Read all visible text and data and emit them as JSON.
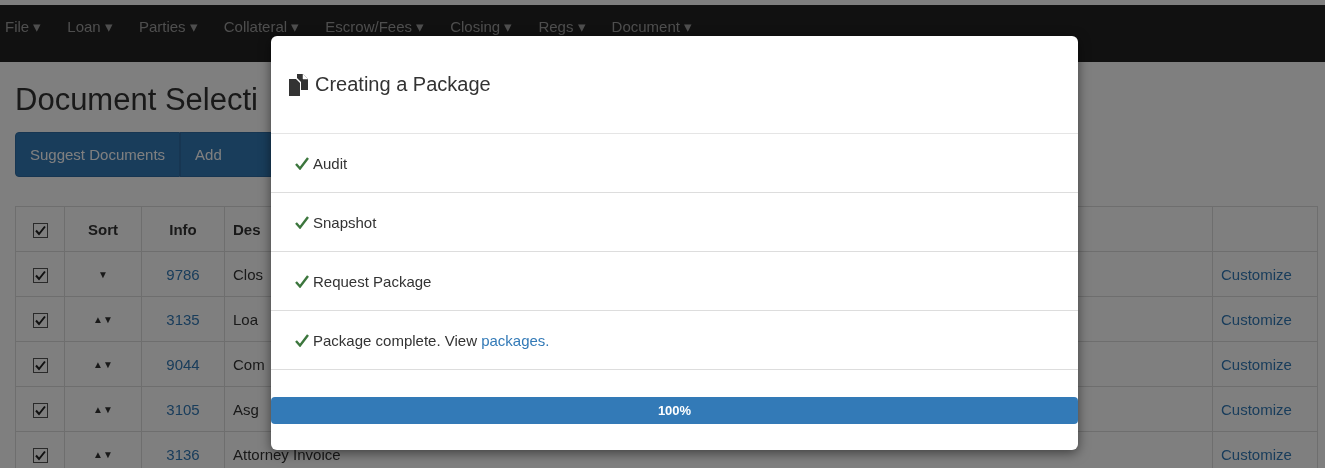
{
  "navbar": {
    "items": [
      {
        "label": "File"
      },
      {
        "label": "Loan"
      },
      {
        "label": "Parties"
      },
      {
        "label": "Collateral"
      },
      {
        "label": "Escrow/Fees"
      },
      {
        "label": "Closing"
      },
      {
        "label": "Regs"
      },
      {
        "label": "Document"
      }
    ],
    "caret": "▾"
  },
  "page": {
    "title": "Document Selecti",
    "buttons": [
      "Suggest Documents",
      "Add"
    ]
  },
  "table": {
    "header": {
      "checked": true,
      "columns": [
        "Sort",
        "Info",
        "Des"
      ]
    },
    "rows": [
      {
        "checked": true,
        "sort": "▼",
        "info": "9786",
        "description": "Clos",
        "action": "Customize"
      },
      {
        "checked": true,
        "sort": "▲▼",
        "info": "3135",
        "description": "Loa",
        "action": "Customize"
      },
      {
        "checked": true,
        "sort": "▲▼",
        "info": "9044",
        "description": "Com",
        "action": "Customize"
      },
      {
        "checked": true,
        "sort": "▲▼",
        "info": "3105",
        "description": "Asg",
        "action": "Customize"
      },
      {
        "checked": true,
        "sort": "▲▼",
        "info": "3136",
        "description": "Attorney Invoice",
        "action": "Customize"
      }
    ]
  },
  "modal": {
    "title": "Creating a Package",
    "steps": [
      {
        "done": true,
        "text": "Audit"
      },
      {
        "done": true,
        "text": "Snapshot"
      },
      {
        "done": true,
        "text": "Request Package"
      },
      {
        "done": true,
        "text": "Package complete. View ",
        "link": "packages."
      }
    ],
    "progress": {
      "level": 1,
      "label": "100%"
    }
  }
}
